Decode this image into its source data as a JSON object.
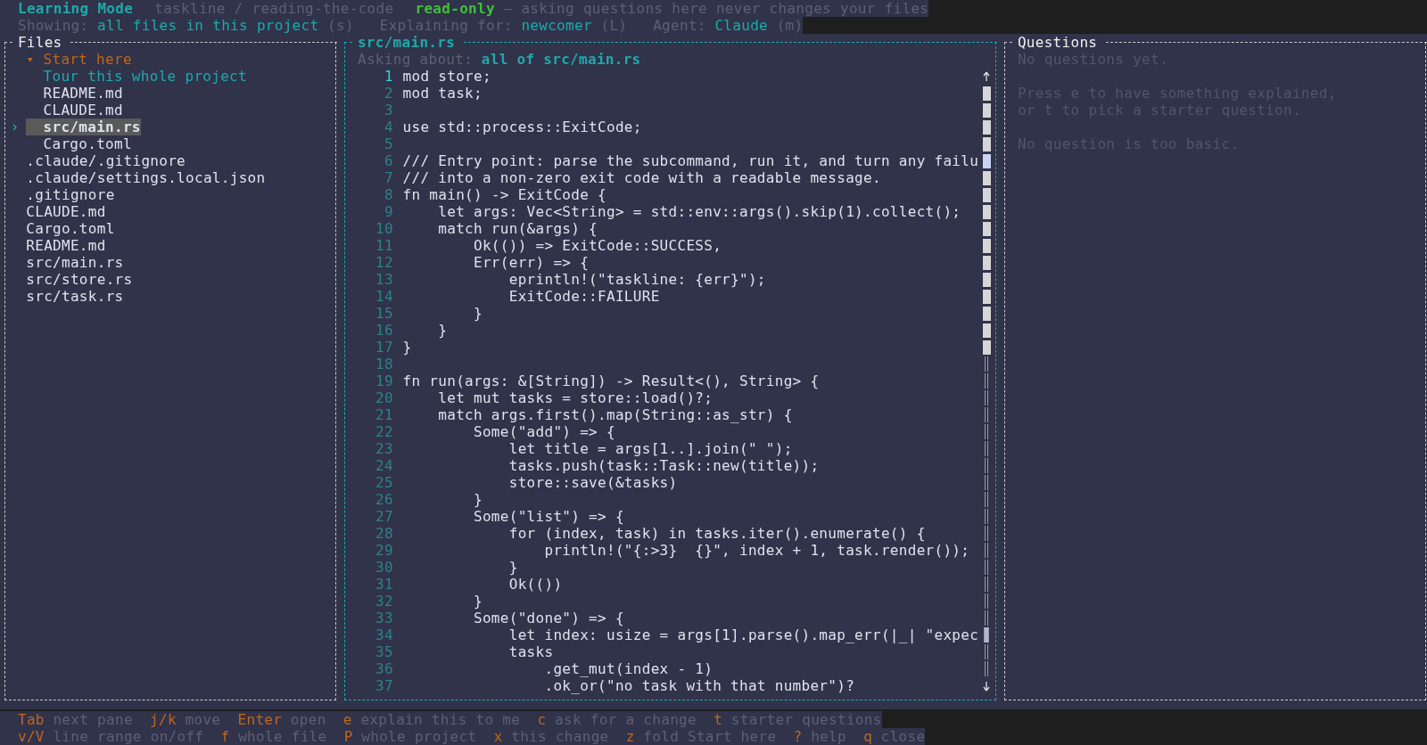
{
  "header": {
    "segments": [
      [
        {
          "kind": "title",
          "text": "Learning Mode"
        }
      ],
      [
        {
          "kind": "dim",
          "text": "taskline / reading-the-code"
        }
      ],
      [
        {
          "kind": "badge",
          "text": "read-only"
        },
        {
          "kind": "dim",
          "text": "— asking questions here never changes your files"
        }
      ]
    ],
    "settings": [
      [
        {
          "kind": "dim",
          "text": "Showing:"
        },
        {
          "kind": "value",
          "text": "all files in this project"
        },
        {
          "kind": "dim",
          "text": "(s)"
        }
      ],
      [
        {
          "kind": "dim",
          "text": "Explaining for:"
        },
        {
          "kind": "value",
          "text": "newcomer"
        },
        {
          "kind": "dim",
          "text": "(L)"
        }
      ],
      [
        {
          "kind": "dim",
          "text": "Agent:"
        },
        {
          "kind": "value",
          "text": "Claude"
        },
        {
          "kind": "dim",
          "text": "(m)"
        }
      ]
    ]
  },
  "files": {
    "title": "Files",
    "items": [
      {
        "kind": "group",
        "label": "Start here",
        "expanded": true,
        "selected": false,
        "children": [
          {
            "kind": "tour",
            "label": "Tour this whole project",
            "selected": false
          },
          {
            "kind": "file",
            "label": "README.md",
            "selected": false
          },
          {
            "kind": "file",
            "label": "CLAUDE.md",
            "selected": false
          },
          {
            "kind": "file",
            "label": "src/main.rs",
            "selected": true
          },
          {
            "kind": "file",
            "label": "Cargo.toml",
            "selected": false
          }
        ]
      },
      {
        "kind": "file",
        "label": ".claude/.gitignore",
        "selected": false
      },
      {
        "kind": "file",
        "label": ".claude/settings.local.json",
        "selected": false
      },
      {
        "kind": "file",
        "label": ".gitignore",
        "selected": false
      },
      {
        "kind": "file",
        "label": "CLAUDE.md",
        "selected": false
      },
      {
        "kind": "file",
        "label": "Cargo.toml",
        "selected": false
      },
      {
        "kind": "file",
        "label": "README.md",
        "selected": false
      },
      {
        "kind": "file",
        "label": "src/main.rs",
        "selected": false
      },
      {
        "kind": "file",
        "label": "src/store.rs",
        "selected": false
      },
      {
        "kind": "file",
        "label": "src/task.rs",
        "selected": false
      }
    ]
  },
  "code": {
    "title": "src/main.rs",
    "asking_label": "Asking about:",
    "asking_value": "all of src/main.rs",
    "lines": [
      {
        "n": "1",
        "text": "mod store;",
        "selected": true,
        "truncated": false
      },
      {
        "n": "2",
        "text": "mod task;",
        "selected": false,
        "truncated": false
      },
      {
        "n": "3",
        "selected": false,
        "truncated": false
      },
      {
        "n": "4",
        "text": "use std::process::ExitCode;",
        "selected": false,
        "truncated": false
      },
      {
        "n": "5",
        "selected": false,
        "truncated": false
      },
      {
        "n": "6",
        "text": "/// Entry point: parse the subcommand, run it, and turn any failu",
        "selected": false,
        "truncated": true
      },
      {
        "n": "7",
        "text": "/// into a non-zero exit code with a readable message.",
        "selected": false,
        "truncated": false
      },
      {
        "n": "8",
        "text": "fn main() -> ExitCode {",
        "selected": false,
        "truncated": false
      },
      {
        "n": "9",
        "text": "    let args: Vec<String> = std::env::args().skip(1).collect();",
        "selected": false,
        "truncated": false
      },
      {
        "n": "10",
        "text": "    match run(&args) {",
        "selected": false,
        "truncated": false
      },
      {
        "n": "11",
        "text": "        Ok(()) => ExitCode::SUCCESS,",
        "selected": false,
        "truncated": false
      },
      {
        "n": "12",
        "text": "        Err(err) => {",
        "selected": false,
        "truncated": false
      },
      {
        "n": "13",
        "text": "            eprintln!(\"taskline: {err}\");",
        "selected": false,
        "truncated": false
      },
      {
        "n": "14",
        "text": "            ExitCode::FAILURE",
        "selected": false,
        "truncated": false
      },
      {
        "n": "15",
        "text": "        }",
        "selected": false,
        "truncated": false
      },
      {
        "n": "16",
        "text": "    }",
        "selected": false,
        "truncated": false
      },
      {
        "n": "17",
        "text": "}",
        "selected": false,
        "truncated": false
      },
      {
        "n": "18",
        "selected": false,
        "truncated": false
      },
      {
        "n": "19",
        "text": "fn run(args: &[String]) -> Result<(), String> {",
        "selected": false,
        "truncated": false
      },
      {
        "n": "20",
        "text": "    let mut tasks = store::load()?;",
        "selected": false,
        "truncated": false
      },
      {
        "n": "21",
        "text": "    match args.first().map(String::as_str) {",
        "selected": false,
        "truncated": false
      },
      {
        "n": "22",
        "text": "        Some(\"add\") => {",
        "selected": false,
        "truncated": false
      },
      {
        "n": "23",
        "text": "            let title = args[1..].join(\" \");",
        "selected": false,
        "truncated": false
      },
      {
        "n": "24",
        "text": "            tasks.push(task::Task::new(title));",
        "selected": false,
        "truncated": false
      },
      {
        "n": "25",
        "text": "            store::save(&tasks)",
        "selected": false,
        "truncated": false
      },
      {
        "n": "26",
        "text": "        }",
        "selected": false,
        "truncated": false
      },
      {
        "n": "27",
        "text": "        Some(\"list\") => {",
        "selected": false,
        "truncated": false
      },
      {
        "n": "28",
        "text": "            for (index, task) in tasks.iter().enumerate() {",
        "selected": false,
        "truncated": false
      },
      {
        "n": "29",
        "text": "                println!(\"{:>3}  {}\", index + 1, task.render());",
        "selected": false,
        "truncated": false
      },
      {
        "n": "30",
        "text": "            }",
        "selected": false,
        "truncated": false
      },
      {
        "n": "31",
        "text": "            Ok(())",
        "selected": false,
        "truncated": false
      },
      {
        "n": "32",
        "text": "        }",
        "selected": false,
        "truncated": false
      },
      {
        "n": "33",
        "text": "        Some(\"done\") => {",
        "selected": false,
        "truncated": false
      },
      {
        "n": "34",
        "text": "            let index: usize = args[1].parse().map_err(|_| \"expec",
        "selected": false,
        "truncated": true
      },
      {
        "n": "35",
        "text": "            tasks",
        "selected": false,
        "truncated": false
      },
      {
        "n": "36",
        "text": "                .get_mut(index - 1)",
        "selected": false,
        "truncated": false
      },
      {
        "n": "37",
        "text": "                .ok_or(\"no task with that number\")?",
        "selected": false,
        "truncated": false
      }
    ]
  },
  "questions": {
    "title": "Questions",
    "paragraphs": [
      [
        "No questions yet."
      ],
      [
        "Press e to have something explained,",
        "or t to pick a starter question."
      ],
      [
        "No question is too basic."
      ]
    ]
  },
  "footer": [
    [
      {
        "key": "Tab",
        "desc": "next pane"
      },
      {
        "key": "j/k",
        "desc": "move"
      },
      {
        "key": "Enter",
        "desc": "open"
      },
      {
        "key": "e",
        "desc": "explain this to me"
      },
      {
        "key": "c",
        "desc": "ask for a change"
      },
      {
        "key": "t",
        "desc": "starter questions"
      }
    ],
    [
      {
        "key": "v/V",
        "desc": "line range on/off"
      },
      {
        "key": "f",
        "desc": "whole file"
      },
      {
        "key": "P",
        "desc": "whole project"
      },
      {
        "key": "x",
        "desc": "this change"
      },
      {
        "key": "z",
        "desc": "fold Start here"
      },
      {
        "key": "?",
        "desc": "help"
      },
      {
        "key": "q",
        "desc": "close"
      }
    ]
  ]
}
